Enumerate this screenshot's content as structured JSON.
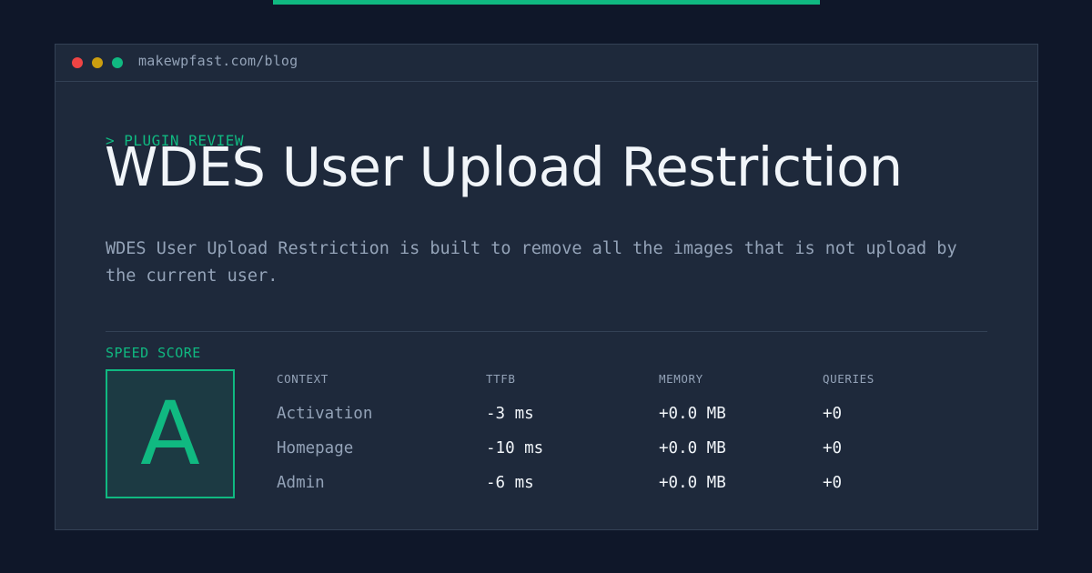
{
  "window": {
    "url": "makewpfast.com/blog"
  },
  "article": {
    "kicker": "> PLUGIN REVIEW",
    "title": "WDES User Upload Restriction",
    "description": "WDES User Upload Restriction is built to remove all the images that is not upload by the current user."
  },
  "speed": {
    "label": "SPEED SCORE",
    "grade": "A"
  },
  "table": {
    "headers": [
      "CONTEXT",
      "TTFB",
      "MEMORY",
      "QUERIES"
    ],
    "rows": [
      {
        "context": "Activation",
        "ttfb": "-3 ms",
        "memory": "+0.0 MB",
        "queries": "+0"
      },
      {
        "context": "Homepage",
        "ttfb": "-10 ms",
        "memory": "+0.0 MB",
        "queries": "+0"
      },
      {
        "context": "Admin",
        "ttfb": "-6 ms",
        "memory": "+0.0 MB",
        "queries": "+0"
      }
    ]
  },
  "colors": {
    "background": "#0f1729",
    "panel": "#1e293b",
    "accent": "#10b981",
    "text": "#f1f5f9",
    "muted": "#94a3b8",
    "close_dot": "#ef4444",
    "minimize_dot": "#eab308",
    "maximize_dot": "#10b981"
  }
}
